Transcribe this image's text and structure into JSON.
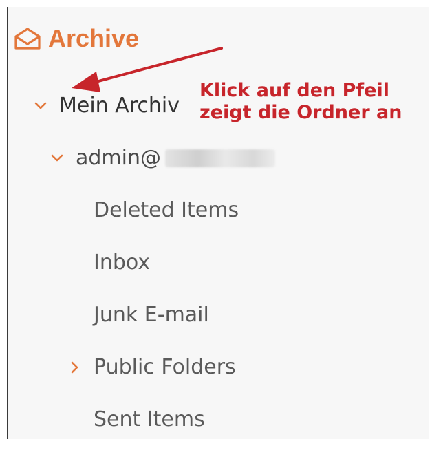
{
  "header": {
    "title": "Archive",
    "icon": "envelope-open-icon"
  },
  "tree": {
    "root": {
      "label": "Mein Archiv",
      "expanded": true
    },
    "account": {
      "label": "admin@",
      "expanded": true,
      "redacted": true
    },
    "folders": [
      {
        "label": "Deleted Items",
        "has_children": false
      },
      {
        "label": "Inbox",
        "has_children": false
      },
      {
        "label": "Junk E-mail",
        "has_children": false
      },
      {
        "label": "Public Folders",
        "has_children": true,
        "expanded": false
      },
      {
        "label": "Sent Items",
        "has_children": false
      }
    ]
  },
  "annotation": {
    "line1": "Klick auf den Pfeil",
    "line2": "zeigt die Ordner an",
    "color": "#c7252b"
  },
  "colors": {
    "accent": "#e3773b",
    "annotation_red": "#c7252b"
  }
}
